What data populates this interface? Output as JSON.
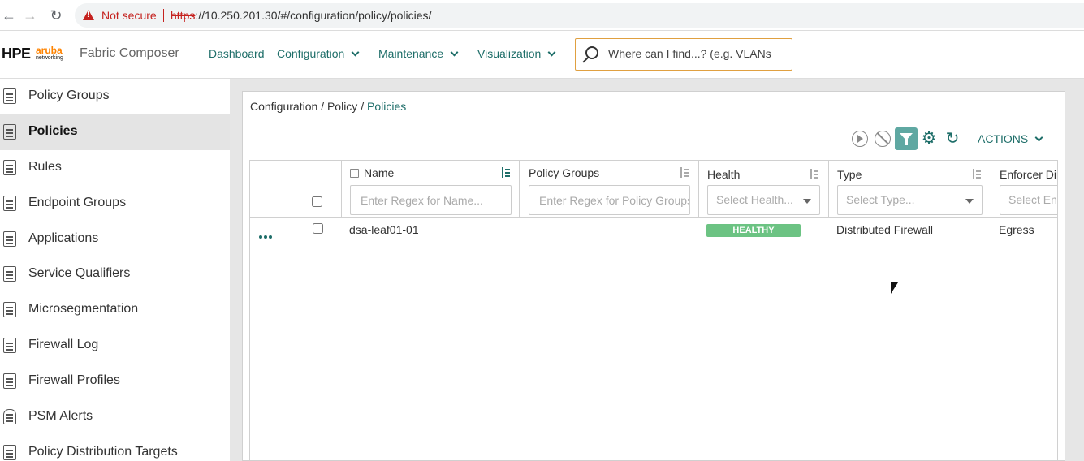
{
  "browser": {
    "not_secure": "Not secure",
    "url_scheme": "https",
    "url_rest": "://10.250.201.30/#/configuration/policy/policies/"
  },
  "header": {
    "logo_hpe": "HPE",
    "logo_aruba": "aruba",
    "logo_networking": "networking",
    "product": "Fabric Composer",
    "nav": [
      {
        "label": "Dashboard"
      },
      {
        "label": "Configuration"
      },
      {
        "label": "Maintenance"
      },
      {
        "label": "Visualization"
      }
    ],
    "search_placeholder": "Where can I find...? (e.g. VLANs"
  },
  "sidebar": {
    "items": [
      {
        "label": "Policy Groups",
        "icon": "policy-groups-icon"
      },
      {
        "label": "Policies",
        "icon": "policies-icon",
        "active": true
      },
      {
        "label": "Rules",
        "icon": "rules-icon"
      },
      {
        "label": "Endpoint Groups",
        "icon": "endpoint-groups-icon"
      },
      {
        "label": "Applications",
        "icon": "applications-icon"
      },
      {
        "label": "Service Qualifiers",
        "icon": "service-qualifiers-icon"
      },
      {
        "label": "Microsegmentation",
        "icon": "microsegmentation-icon"
      },
      {
        "label": "Firewall Log",
        "icon": "firewall-log-icon"
      },
      {
        "label": "Firewall Profiles",
        "icon": "firewall-profiles-icon"
      },
      {
        "label": "PSM Alerts",
        "icon": "bell-icon"
      },
      {
        "label": "Policy Distribution Targets",
        "icon": "distribution-icon"
      }
    ]
  },
  "main": {
    "breadcrumb": {
      "part1": "Configuration",
      "sep": " / ",
      "part2": "Policy",
      "current": "Policies"
    },
    "toolbar": {
      "actions_label": "ACTIONS"
    },
    "table": {
      "columns": [
        {
          "label": "Name",
          "filter_placeholder": "Enter Regex for Name..."
        },
        {
          "label": "Policy Groups",
          "filter_placeholder": "Enter Regex for Policy Groups"
        },
        {
          "label": "Health",
          "select_placeholder": "Select Health..."
        },
        {
          "label": "Type",
          "select_placeholder": "Select Type..."
        },
        {
          "label": "Enforcer Dire",
          "select_placeholder": "Select Enfo"
        }
      ],
      "rows": [
        {
          "name": "dsa-leaf01-01",
          "policy_groups": "",
          "health": "HEALTHY",
          "type": "Distributed Firewall",
          "enforcer_direction": "Egress"
        }
      ]
    }
  },
  "colors": {
    "accent": "#1e6e69",
    "healthy": "#6cc383",
    "warning": "#c5221f",
    "brand_orange": "#ff8300"
  }
}
